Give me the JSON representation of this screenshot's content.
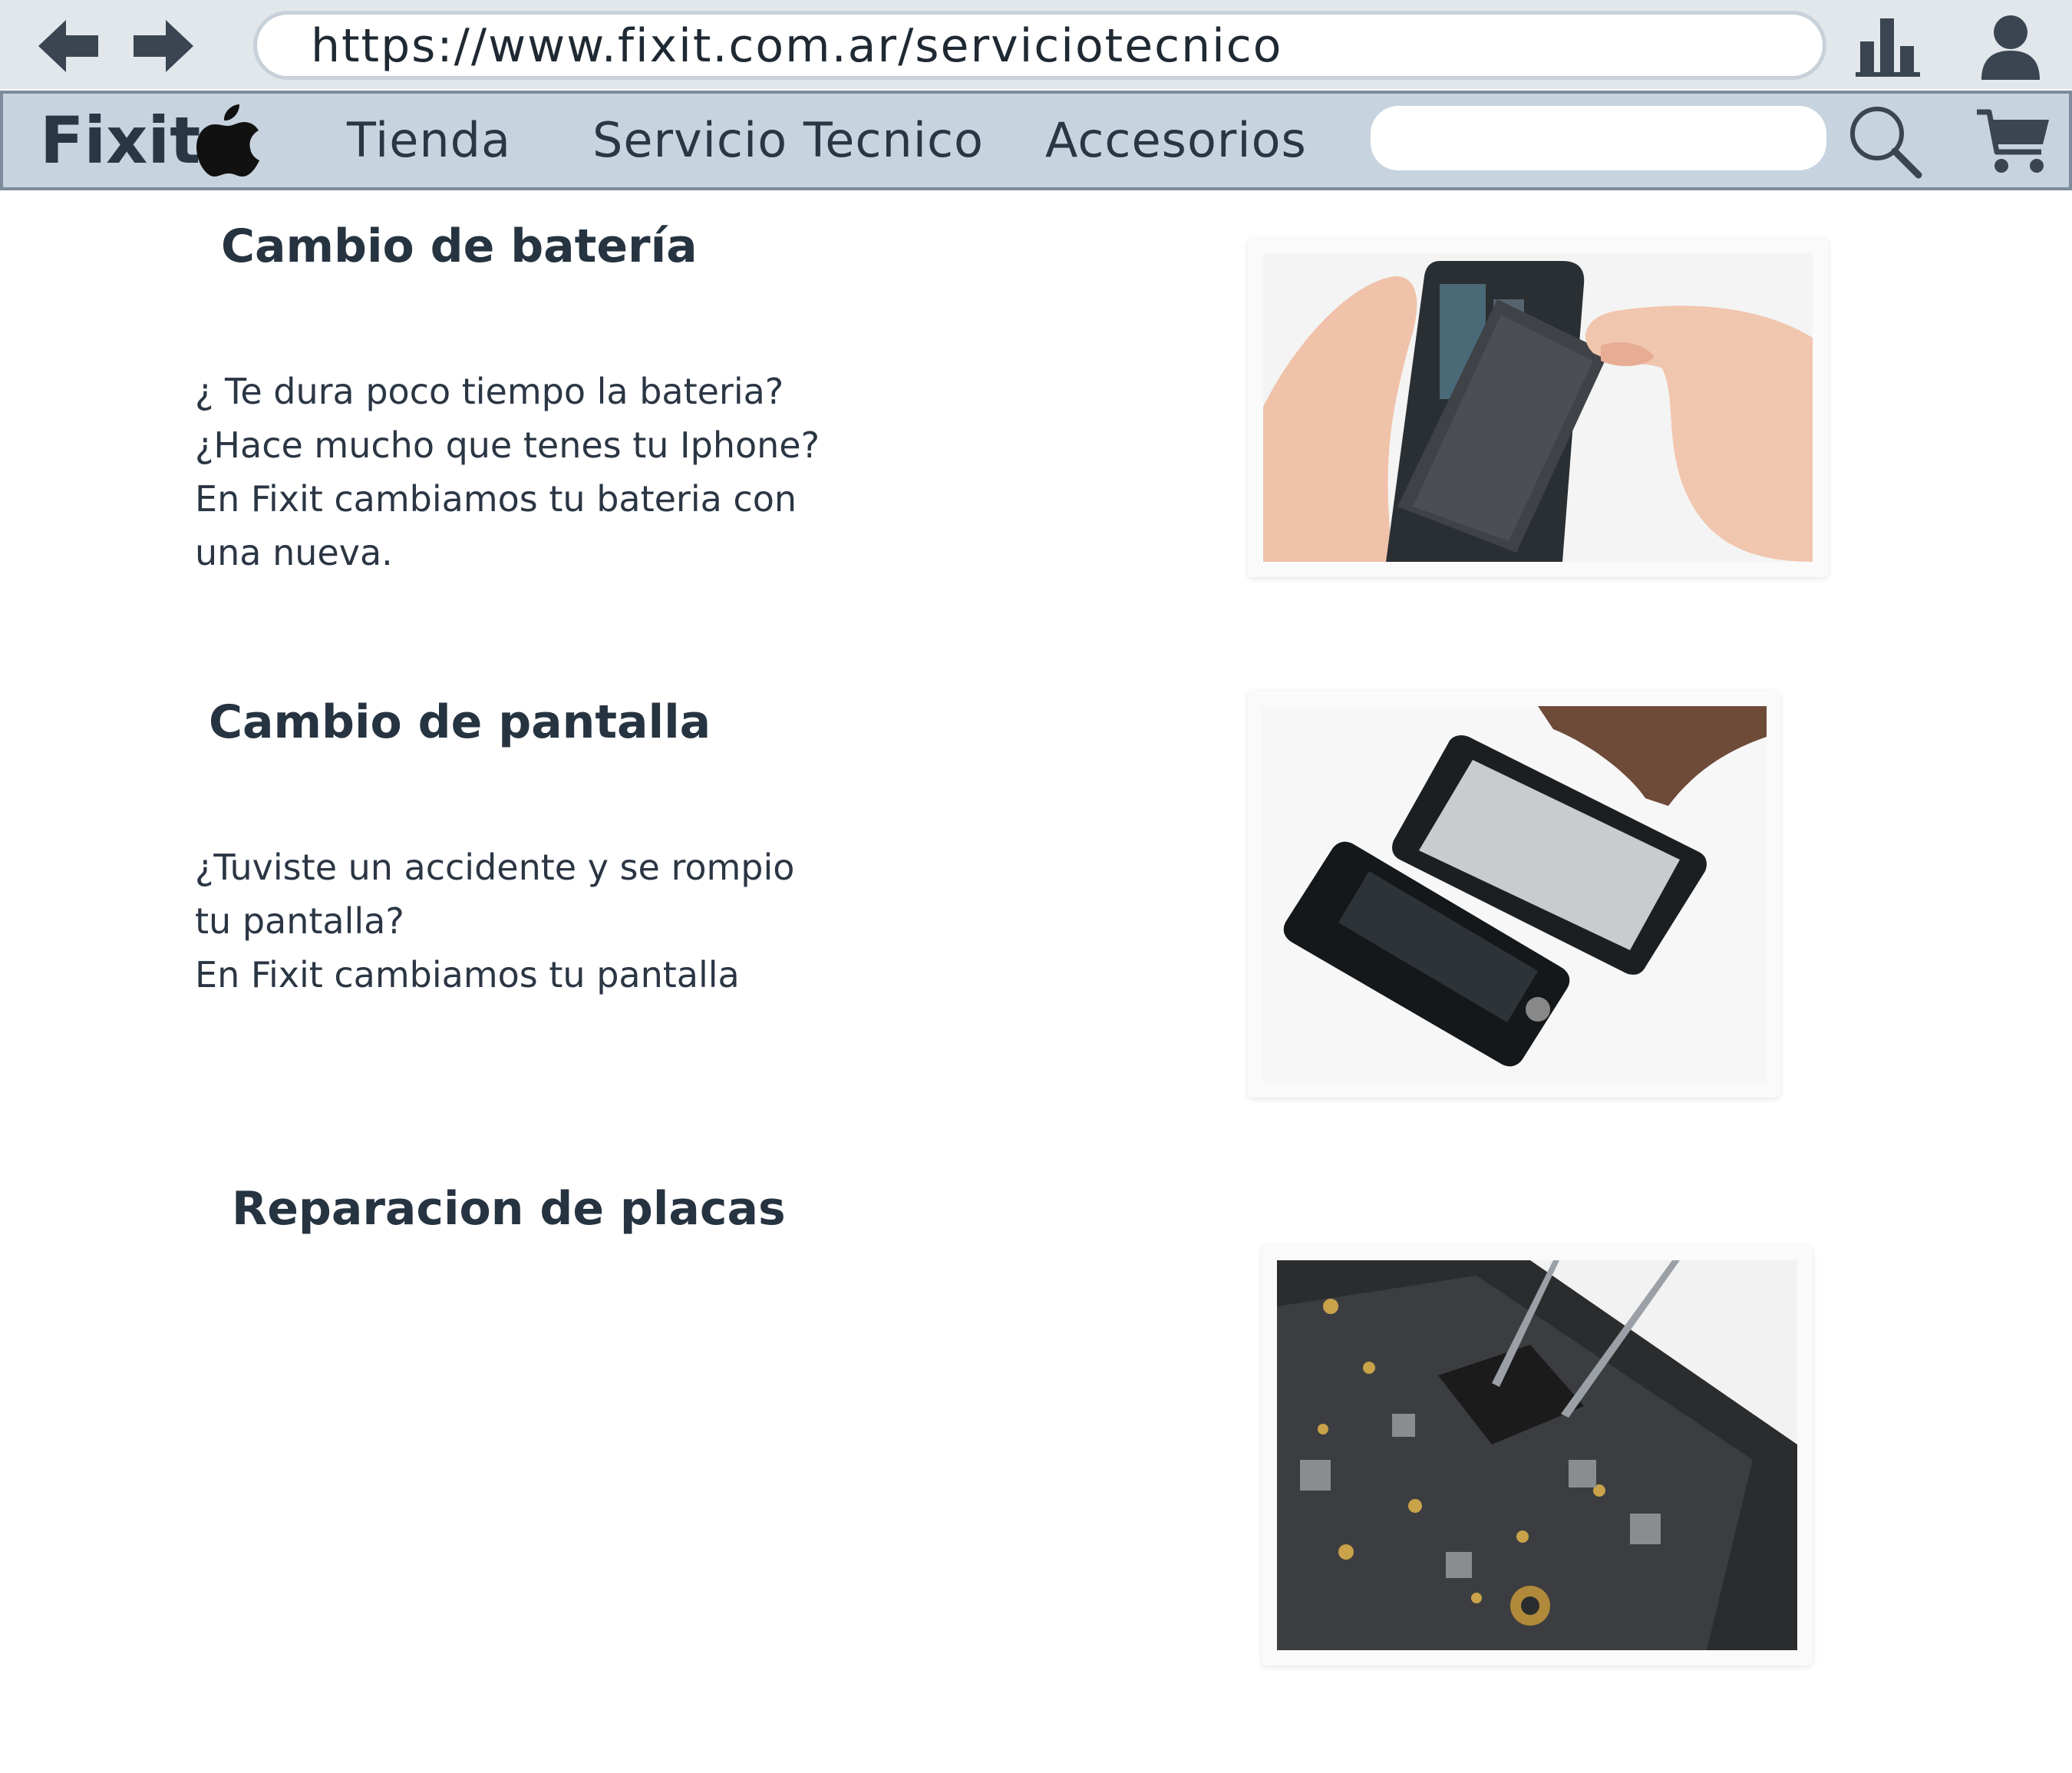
{
  "browser": {
    "url": "https://www.fixit.com.ar/serviciotecnico",
    "icons": [
      "back-arrow-icon",
      "forward-arrow-icon",
      "bar-chart-icon",
      "user-icon"
    ]
  },
  "navbar": {
    "logo": "Fixit",
    "logo_icon": "apple-icon",
    "links": [
      "Tienda",
      "Servicio Tecnico",
      "Accesorios"
    ],
    "search": {
      "placeholder": "",
      "value": ""
    },
    "icons": [
      "search-icon",
      "cart-icon"
    ]
  },
  "services": [
    {
      "title": "Cambio de batería",
      "lines": [
        "¿ Te dura poco tiempo la bateria?",
        "¿Hace mucho que tenes tu Iphone?",
        "En Fixit cambiamos tu bateria con",
        "una nueva."
      ],
      "image": "battery-replacement-photo"
    },
    {
      "title": "Cambio de pantalla",
      "lines": [
        "¿Tuviste un accidente y se rompio",
        "tu pantalla?",
        "En Fixit cambiamos tu pantalla"
      ],
      "image": "screen-replacement-photo"
    },
    {
      "title": "Reparacion de placas",
      "lines": [],
      "image": "board-repair-photo"
    }
  ],
  "colors": {
    "chrome_bg": "#e2e7ec",
    "navbar_bg": "#c7d3de",
    "navbar_border": "#7c8c9c",
    "text_dark": "#2b3644",
    "icon_dark": "#3b4552"
  }
}
